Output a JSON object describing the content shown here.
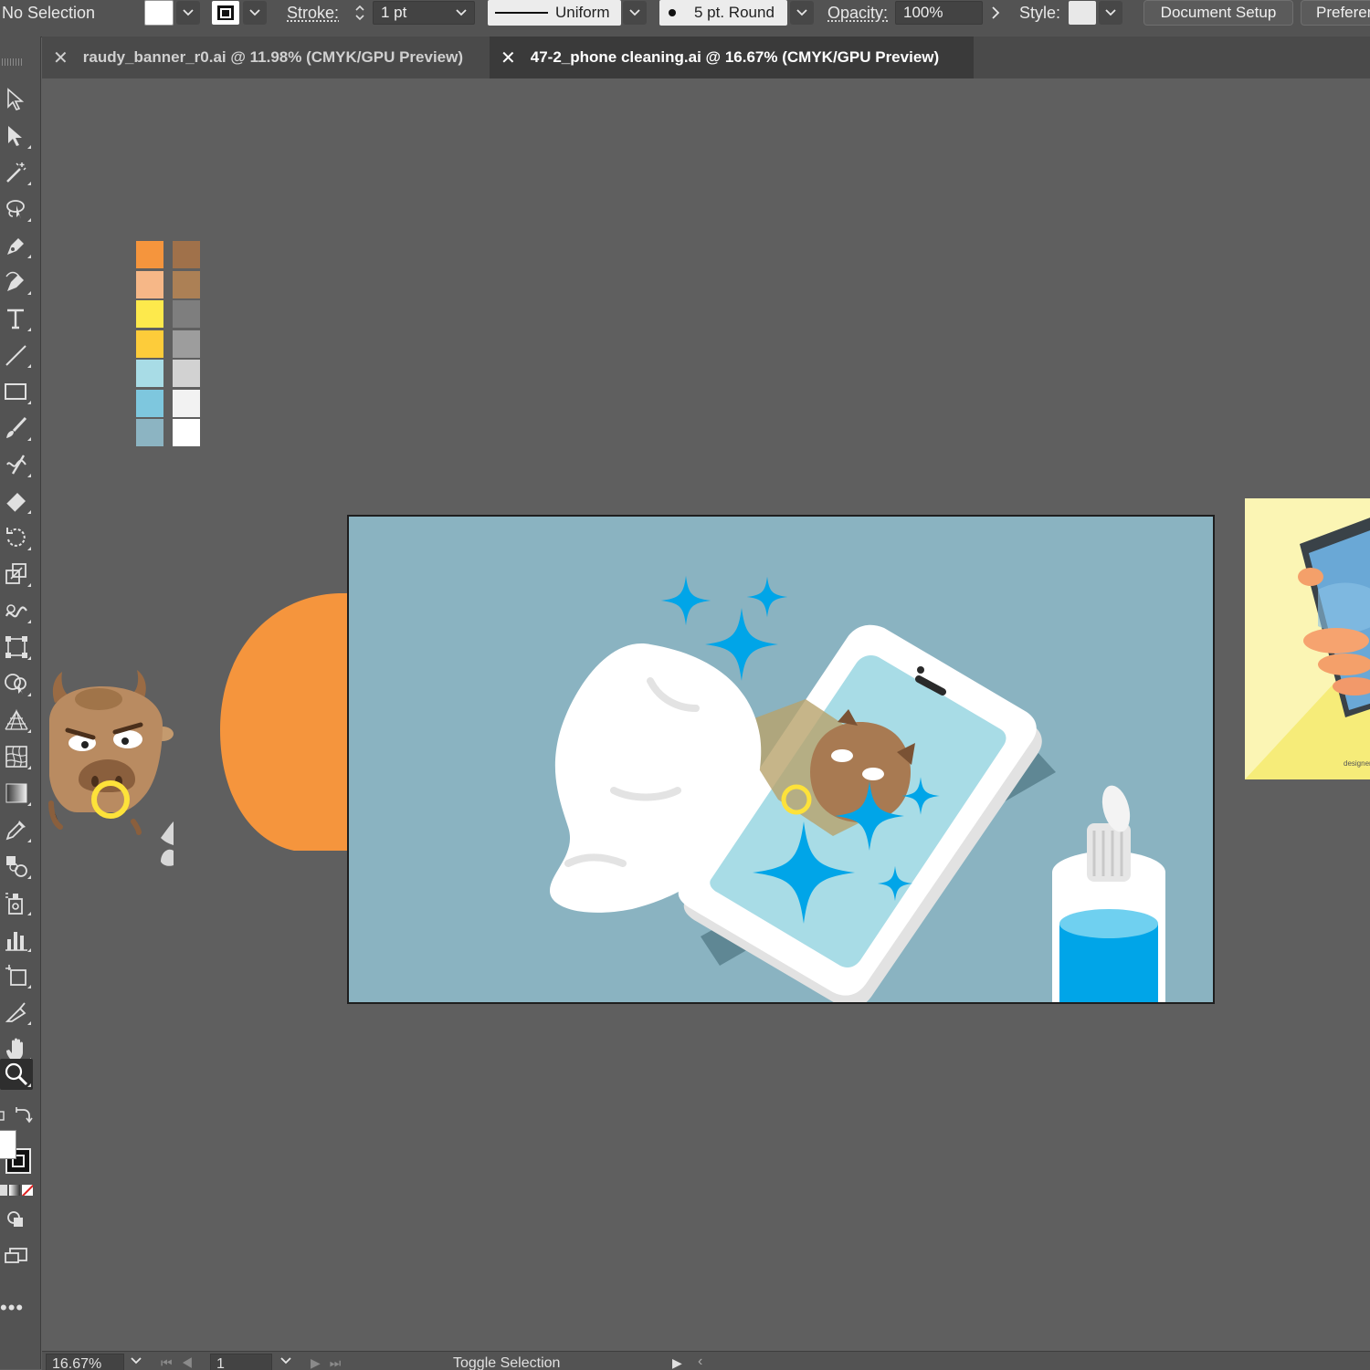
{
  "control_bar": {
    "selection_status": "No Selection",
    "fill_swatch_color": "#ffffff",
    "stroke_label": "Stroke:",
    "stroke_weight": "1 pt",
    "stroke_profile": "Uniform",
    "brush": "5 pt. Round",
    "opacity_label": "Opacity:",
    "opacity_value": "100%",
    "style_label": "Style:",
    "document_setup_label": "Document Setup",
    "preferences_label": "Preferen"
  },
  "tabs": [
    {
      "label": "raudy_banner_r0.ai @ 11.98% (CMYK/GPU Preview)",
      "active": false
    },
    {
      "label": "47-2_phone cleaning.ai @ 16.67% (CMYK/GPU Preview)",
      "active": true
    }
  ],
  "toolbar": {
    "tools": [
      "selection-tool",
      "direct-selection-tool",
      "magic-wand-tool",
      "lasso-tool",
      "pen-tool",
      "curvature-tool",
      "type-tool",
      "line-segment-tool",
      "rectangle-tool",
      "paintbrush-tool",
      "shaper-tool",
      "eraser-tool",
      "rotate-tool",
      "scale-tool",
      "warp-tool",
      "free-transform-tool",
      "shape-builder-tool",
      "perspective-grid-tool",
      "mesh-tool",
      "gradient-tool",
      "eyedropper-tool",
      "blend-tool",
      "symbol-sprayer-tool",
      "column-graph-tool",
      "artboard-tool",
      "slice-tool",
      "hand-tool",
      "zoom-tool"
    ],
    "active_tool": "zoom-tool"
  },
  "palette": {
    "left_column": [
      "#f5953d",
      "#f6b787",
      "#fde94c",
      "#fdcc3a",
      "#a8dce6",
      "#7ec7de",
      "#8cb4c2"
    ],
    "right_column": [
      "#a0714a",
      "#ac8055",
      "#7e7e7e",
      "#9d9d9d",
      "#d2d2d2",
      "#f2f2f2",
      "#ffffff"
    ]
  },
  "artboard": {
    "background_color": "#8ab3c1",
    "accent_color": "#00a5e8",
    "side_artwork_text": "designer"
  },
  "status_bar": {
    "zoom": "16.67%",
    "artboard_number": "1",
    "toggle_label": "Toggle Selection"
  }
}
